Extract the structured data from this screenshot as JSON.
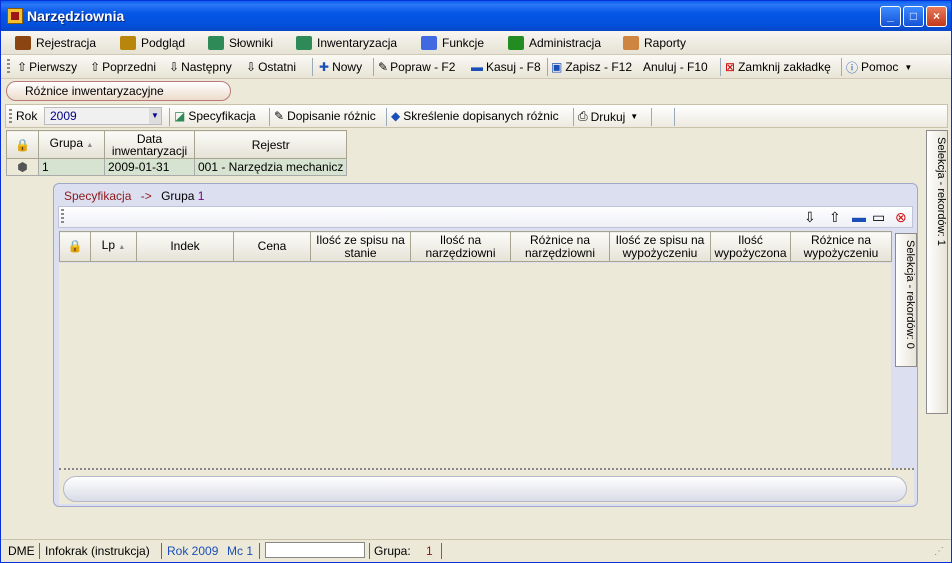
{
  "window": {
    "title": "Narzędziownia",
    "controls": {
      "minimize": "_",
      "maximize": "□",
      "close": "×"
    }
  },
  "menu": [
    {
      "label": "Rejestracja",
      "icon": "registration-icon",
      "color": "#8b4513"
    },
    {
      "label": "Podgląd",
      "icon": "preview-icon",
      "color": "#b8860b"
    },
    {
      "label": "Słowniki",
      "icon": "dictionary-icon",
      "color": "#2e8b57"
    },
    {
      "label": "Inwentaryzacja",
      "icon": "inventory-icon",
      "color": "#2e8b57"
    },
    {
      "label": "Funkcje",
      "icon": "functions-icon",
      "color": "#4169e1"
    },
    {
      "label": "Administracja",
      "icon": "admin-icon",
      "color": "#228b22"
    },
    {
      "label": "Raporty",
      "icon": "reports-icon",
      "color": "#cd853f"
    }
  ],
  "toolbar": {
    "first": "Pierwszy",
    "prev": "Poprzedni",
    "next": "Następny",
    "last": "Ostatni",
    "new": "Nowy",
    "edit": "Popraw - F2",
    "delete": "Kasuj - F8",
    "save": "Zapisz - F12",
    "cancel": "Anuluj - F10",
    "close_tab": "Zamknij zakładkę",
    "help": "Pomoc"
  },
  "tab": {
    "label": "Różnice inwentaryzacyjne"
  },
  "rokbar": {
    "rok_label": "Rok",
    "rok_value": "2009",
    "specyfikacja": "Specyfikacja",
    "dopisanie": "Dopisanie różnic",
    "skreslenie": "Skreślenie dopisanych różnic",
    "drukuj": "Drukuj"
  },
  "grid1": {
    "headers": [
      "Grupa",
      "Data inwentaryzacji",
      "Rejestr"
    ],
    "rows": [
      {
        "grupa": "1",
        "data": "2009-01-31",
        "rejestr": "001 - Narzędzia mechanicz"
      }
    ]
  },
  "right_tab": {
    "label": "Selekcja - rekordów: 1"
  },
  "inner": {
    "crumb_a": "Specyfikacja",
    "crumb_arrow": "->",
    "crumb_b": "Grupa",
    "crumb_val": "1",
    "headers": [
      "Lp",
      "Indek",
      "Cena",
      "Ilość ze spisu na stanie",
      "Ilość na narzędziowni",
      "Różnice na narzędziowni",
      "Ilość ze spisu na wypożyczeniu",
      "Ilość wypożyczona",
      "Różnice na wypożyczeniu"
    ],
    "side_tab": "Selekcja - rekordów: 0"
  },
  "status": {
    "dme": "DME",
    "infokrak": "Infokrak (instrukcja)",
    "rok": "Rok 2009",
    "mc": "Mc 1",
    "grupa_label": "Grupa:",
    "grupa_val": "1"
  }
}
